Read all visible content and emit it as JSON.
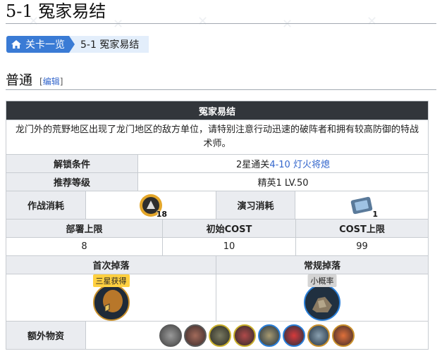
{
  "page": {
    "title": "5-1 冤家易结"
  },
  "breadcrumb": {
    "home_label": "关卡一览",
    "current": "5-1 冤家易结"
  },
  "section": {
    "title": "普通",
    "edit_open": "[",
    "edit_label": "编辑",
    "edit_close": "]"
  },
  "stage": {
    "name": "冤家易结",
    "description": "龙门外的荒野地区出现了龙门地区的敌方单位，请特别注意行动迅速的破阵者和拥有较高防御的特战术师。",
    "unlock": {
      "label": "解锁条件",
      "prefix": "2星通关",
      "link": "4-10 灯火将熄"
    },
    "recommend": {
      "label": "推荐等级",
      "value": "精英1 LV.50"
    },
    "battle_cost": {
      "label": "作战消耗",
      "count": "18"
    },
    "practice_cost": {
      "label": "演习消耗",
      "count": "1"
    },
    "deploy": {
      "label": "部署上限",
      "value": "8"
    },
    "initial_cost": {
      "label": "初始COST",
      "value": "10"
    },
    "cost_limit": {
      "label": "COST上限",
      "value": "99"
    },
    "first_drop": {
      "label": "首次掉落",
      "badge": "三星获得"
    },
    "normal_drop": {
      "label": "常规掉落",
      "badge": "小概率"
    },
    "extra": {
      "label": "额外物资"
    }
  },
  "colors": {
    "accent": "#3a7bd5",
    "header_dark": "#32363b",
    "header_light": "#eaecf0",
    "badge_gold": "#ffd040"
  }
}
